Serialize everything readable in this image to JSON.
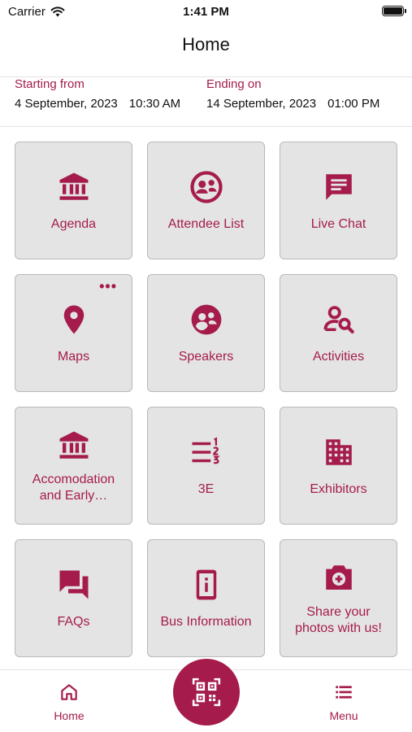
{
  "status_bar": {
    "carrier": "Carrier",
    "time": "1:41 PM"
  },
  "nav": {
    "title": "Home"
  },
  "event_dates": {
    "start_label": "Starting from",
    "start_date": "4 September, 2023",
    "start_time": "10:30 AM",
    "end_label": "Ending on",
    "end_date": "14 September, 2023",
    "end_time": "01:00 PM"
  },
  "tiles": [
    {
      "label": "Agenda",
      "icon": "bank-icon"
    },
    {
      "label": "Attendee List",
      "icon": "people-circle-icon"
    },
    {
      "label": "Live Chat",
      "icon": "chat-bubble-icon"
    },
    {
      "label": "Maps",
      "icon": "map-pin-icon",
      "more": "•••"
    },
    {
      "label": "Speakers",
      "icon": "people-circle-icon"
    },
    {
      "label": "Activities",
      "icon": "person-search-icon"
    },
    {
      "label": "Accomodation and Early…",
      "icon": "bank-icon"
    },
    {
      "label": "3E",
      "icon": "numbered-list-icon"
    },
    {
      "label": "Exhibitors",
      "icon": "building-icon"
    },
    {
      "label": "FAQs",
      "icon": "forum-icon"
    },
    {
      "label": "Bus Information",
      "icon": "info-device-icon"
    },
    {
      "label": "Share your photos with us!",
      "icon": "add-photo-icon"
    }
  ],
  "tabbar": {
    "home_label": "Home",
    "menu_label": "Menu"
  },
  "colors": {
    "accent": "#a51c4c",
    "tile_bg": "#e4e4e4",
    "tile_border": "#b9b9b9"
  }
}
